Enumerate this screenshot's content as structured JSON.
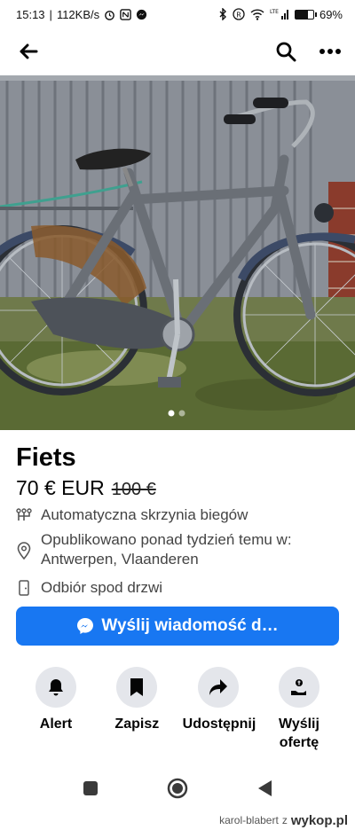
{
  "status_bar": {
    "time": "15:13",
    "speed": "112KB/s",
    "battery": "69%",
    "battery_level": 0.69,
    "network": "LTE"
  },
  "nav": {
    "back_icon": "arrow-left-icon",
    "search_icon": "search-icon",
    "more_icon": "more-dots-icon"
  },
  "listing": {
    "title": "Fiets",
    "price": "70 € EUR",
    "old_price": "100 €",
    "transmission": "Automatyczna skrzynia biegów",
    "published_line1": "Opublikowano ponad tydzień temu w:",
    "published_line2": "Antwerpen, Vlaanderen",
    "pickup": "Odbiór spod drzwi"
  },
  "photo": {
    "image_count": 2,
    "active_index": 0
  },
  "cta": {
    "label": "Wyślij wiadomość d…",
    "color": "#1877f2"
  },
  "actions": [
    {
      "label": "Alert",
      "icon": "bell-icon"
    },
    {
      "label": "Zapisz",
      "icon": "bookmark-icon"
    },
    {
      "label": "Udostępnij",
      "icon": "share-icon"
    },
    {
      "label": "Wyślij ofertę",
      "icon": "offer-icon"
    }
  ],
  "watermark": {
    "user": "karol-blabert",
    "suffix": "z",
    "brand": "wykop.pl"
  }
}
